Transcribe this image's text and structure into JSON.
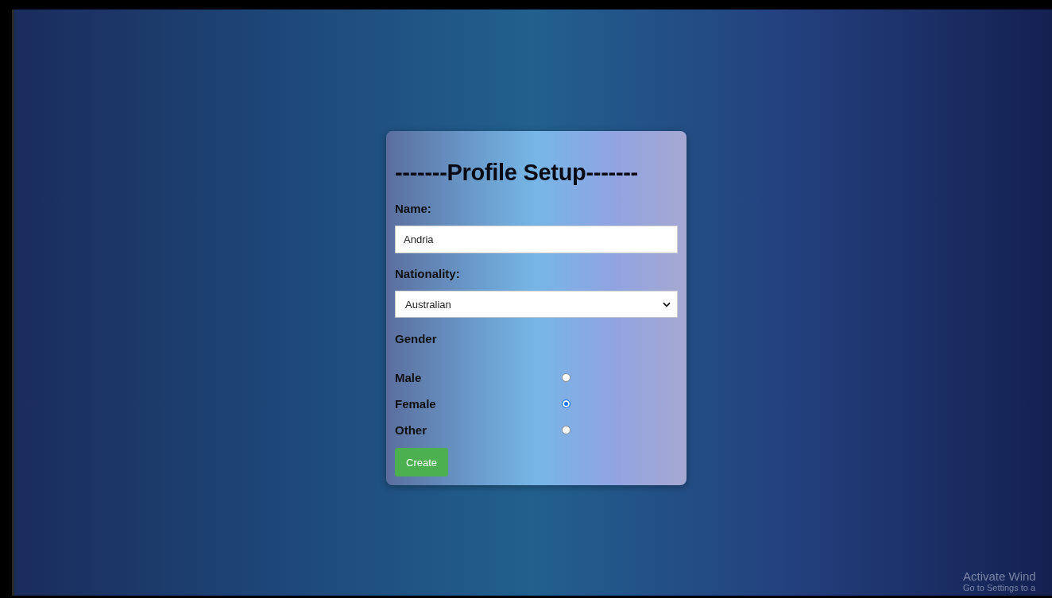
{
  "form": {
    "title": "-------Profile Setup-------",
    "name_label": "Name:",
    "name_value": "Andria",
    "nationality_label": "Nationality:",
    "nationality_value": "Australian",
    "gender_label": "Gender",
    "gender_options": [
      {
        "label": "Male",
        "selected": false
      },
      {
        "label": "Female",
        "selected": true
      },
      {
        "label": "Other",
        "selected": false
      }
    ],
    "submit_button": "Create"
  },
  "os_notice": {
    "title": "Activate Wind",
    "subtitle": "Go to Settings to a"
  }
}
